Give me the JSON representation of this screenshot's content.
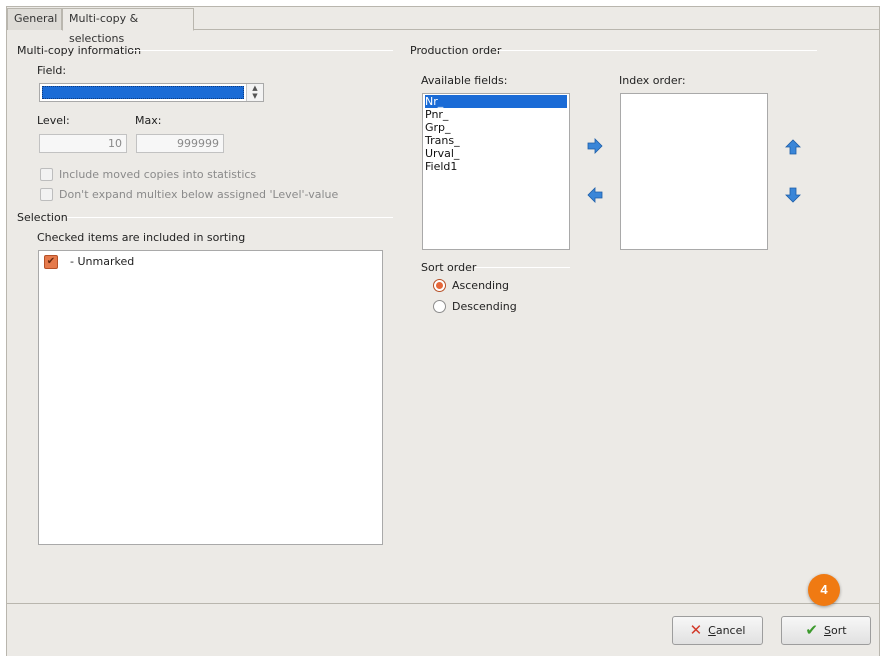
{
  "tabs": [
    {
      "label": "General",
      "active": false
    },
    {
      "label": "Multi-copy & selections",
      "active": true
    }
  ],
  "multicopy": {
    "title": "Multi-copy information",
    "field_label": "Field:",
    "field_value": "",
    "level_label": "Level:",
    "level_value": "10",
    "max_label": "Max:",
    "max_value": "999999",
    "include_moved_label": "Include moved copies into statistics",
    "include_moved_checked": false,
    "dont_expand_label": "Don't expand multiex below assigned 'Level'-value",
    "dont_expand_checked": false
  },
  "selection": {
    "title": "Selection",
    "subtitle": "Checked items are included in sorting",
    "items": [
      {
        "label": "- Unmarked",
        "checked": true
      }
    ]
  },
  "production_order": {
    "title": "Production order",
    "available_label": "Available fields:",
    "available_fields": [
      "Nr_",
      "Pnr_",
      "Grp_",
      "Trans_",
      "Urval_",
      "Field1"
    ],
    "selected_available": "Nr_",
    "index_label": "Index order:",
    "index_fields": [],
    "icons": {
      "add": "arrow-right-icon",
      "remove": "arrow-left-icon",
      "move_up": "arrow-up-icon",
      "move_down": "arrow-down-icon"
    }
  },
  "sort_order": {
    "title": "Sort order",
    "ascending_label": "Ascending",
    "descending_label": "Descending",
    "selected": "Ascending"
  },
  "footer": {
    "cancel_label": "Cancel",
    "cancel_mnemonic": "C",
    "cancel_rest": "ancel",
    "sort_label": "Sort",
    "sort_mnemonic": "S",
    "sort_rest": "ort",
    "step_badge": "4"
  },
  "colors": {
    "accent_orange": "#e57a4c",
    "selection_blue": "#1a6bd6",
    "badge_orange": "#f07a12",
    "arrow_blue": "#3a86d8"
  }
}
